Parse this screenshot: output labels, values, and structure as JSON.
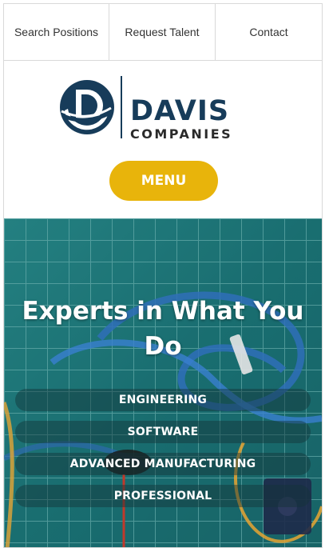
{
  "topnav": {
    "items": [
      {
        "label": "Search Positions"
      },
      {
        "label": "Request Talent"
      },
      {
        "label": "Contact"
      }
    ]
  },
  "header": {
    "logo": {
      "brand_top": "DAVIS",
      "brand_bottom": "COMPANIES",
      "brand_color": "#173c5a"
    },
    "menu_label": "MENU",
    "menu_color": "#e8b40b"
  },
  "hero": {
    "title": "Experts in What You Do",
    "categories": [
      {
        "label": "ENGINEERING"
      },
      {
        "label": "SOFTWARE"
      },
      {
        "label": "ADVANCED MANUFACTURING"
      },
      {
        "label": "PROFESSIONAL"
      }
    ],
    "background_color": "#1f7f80"
  }
}
